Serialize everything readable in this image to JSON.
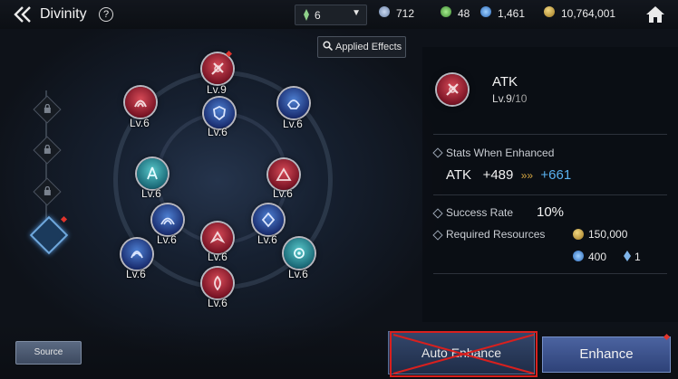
{
  "header": {
    "title": "Divinity",
    "help_icon": "?",
    "selector_value": "6",
    "currency1": "712",
    "currency2": "48",
    "currency3": "1,461",
    "gold": "10,764,001"
  },
  "applied_effects_label": "Applied Effects",
  "nodes": [
    {
      "name": "node-top",
      "level": "Lv.9",
      "color": "red"
    },
    {
      "name": "node-upper-left",
      "level": "Lv.6",
      "color": "red"
    },
    {
      "name": "node-inner-top",
      "level": "Lv.6",
      "color": "blue"
    },
    {
      "name": "node-upper-right",
      "level": "Lv.6",
      "color": "blue"
    },
    {
      "name": "node-mid-left",
      "level": "Lv.6",
      "color": "teal"
    },
    {
      "name": "node-mid-right",
      "level": "Lv.6",
      "color": "red"
    },
    {
      "name": "node-inner-left",
      "level": "Lv.6",
      "color": "blue"
    },
    {
      "name": "node-center",
      "level": "Lv.6",
      "color": "red"
    },
    {
      "name": "node-inner-right",
      "level": "Lv.6",
      "color": "blue"
    },
    {
      "name": "node-lower-left",
      "level": "Lv.6",
      "color": "blue"
    },
    {
      "name": "node-lower-right",
      "level": "Lv.6",
      "color": "teal"
    },
    {
      "name": "node-bottom",
      "level": "Lv.6",
      "color": "red"
    }
  ],
  "detail": {
    "stat_name": "ATK",
    "level": "Lv.9",
    "max_level": "/10",
    "stats_label": "Stats When Enhanced",
    "stat_key": "ATK",
    "current_value": "+489",
    "arrow": "»»",
    "next_value": "+661",
    "success_label": "Success Rate",
    "success_value": "10%",
    "resources_label": "Required Resources",
    "gold_cost": "150,000",
    "gem_cost": "400",
    "crystal_cost": "1"
  },
  "buttons": {
    "source": "Source",
    "auto_enhance": "Auto Enhance",
    "enhance": "Enhance"
  },
  "colors": {
    "accent_blue": "#5ab1f0",
    "highlight_red": "#d8201e",
    "gold": "#d3a440"
  }
}
